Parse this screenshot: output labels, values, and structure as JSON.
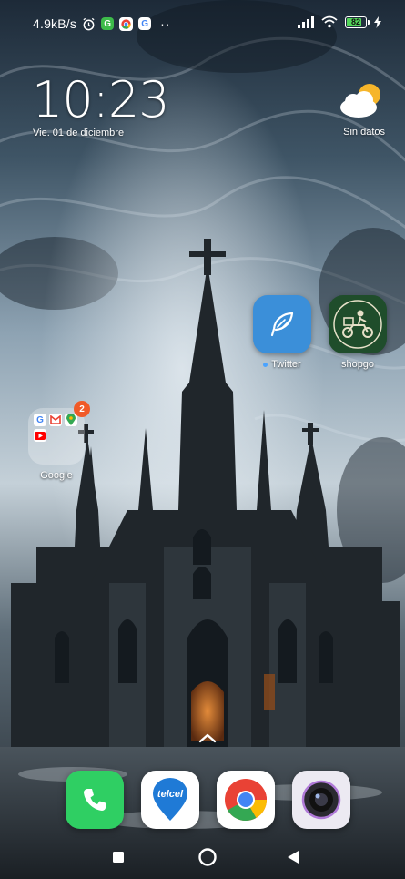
{
  "status_bar": {
    "network_speed": "4.9kB/s",
    "more_indicator": "··",
    "battery_level": "82",
    "battery_percent": 82,
    "icons": [
      "alarm-icon",
      "green-app-icon",
      "chrome-icon",
      "google-icon",
      "signal-icon",
      "wifi-icon",
      "battery-icon",
      "charging-icon"
    ]
  },
  "clock_widget": {
    "time": "10:23",
    "date": "Vie. 01 de diciembre"
  },
  "weather_widget": {
    "icon": "partly-cloudy-icon",
    "label": "Sin datos"
  },
  "apps": [
    {
      "label": "Twitter",
      "icon": "feather-icon",
      "color": "#3b8fd9",
      "new": true
    },
    {
      "label": "shopgo",
      "icon": "scooter-delivery-icon",
      "color": "#1f4d2b",
      "new": false
    }
  ],
  "folder": {
    "label": "Google",
    "badge": "2",
    "contents": [
      "google-icon",
      "gmail-icon",
      "maps-icon",
      "youtube-icon"
    ]
  },
  "dock": [
    {
      "name": "Phone",
      "icon": "phone-icon",
      "color": "#2fcf63"
    },
    {
      "name": "Telcel",
      "icon": "telcel-icon",
      "color": "#ffffff",
      "text": "telcel"
    },
    {
      "name": "Chrome",
      "icon": "chrome-icon",
      "color": "#ffffff"
    },
    {
      "name": "Camera",
      "icon": "camera-icon",
      "color": "#eceaf2"
    }
  ],
  "nav_bar": [
    "recents-button",
    "home-button",
    "back-button"
  ]
}
